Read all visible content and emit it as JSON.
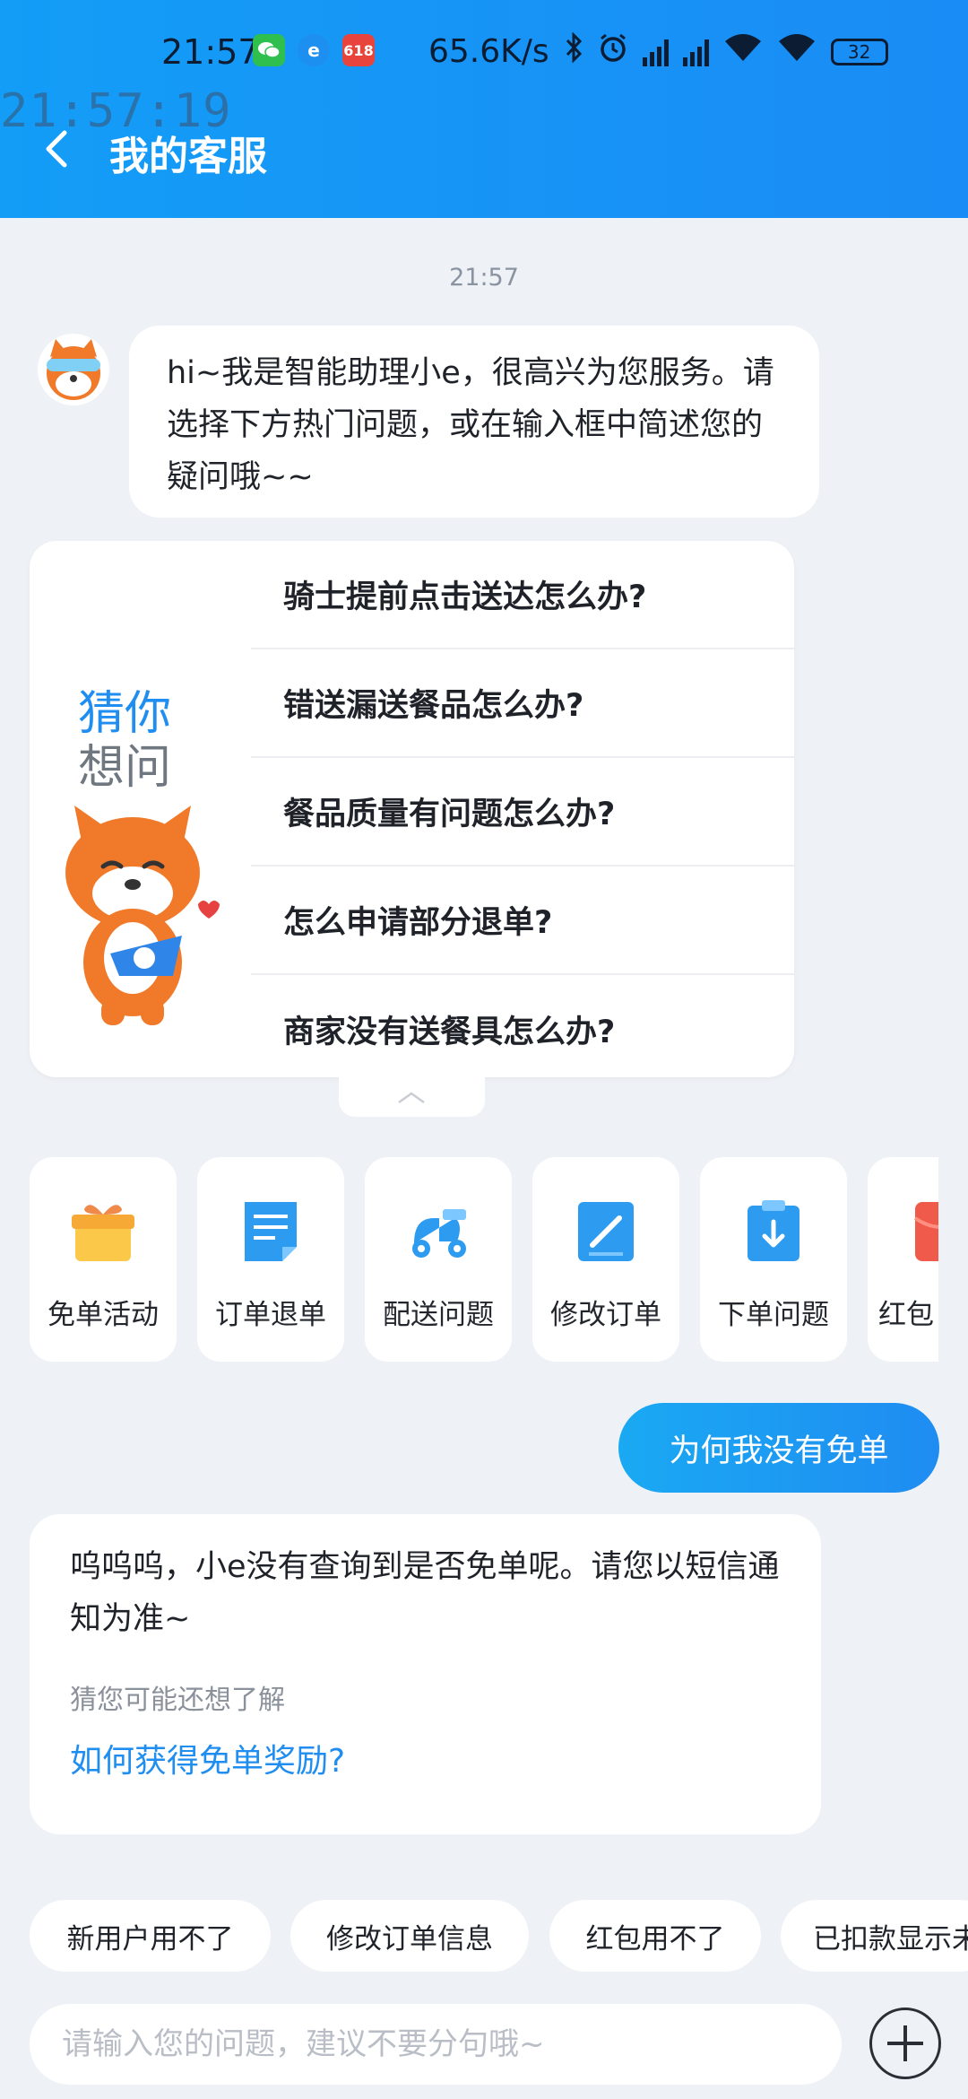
{
  "status_bar": {
    "time": "21:57",
    "net_speed": "65.6K/s",
    "battery": "32",
    "promo_badge": "618",
    "e_badge": "e"
  },
  "overlay_clock": "21:57:19",
  "header": {
    "title": "我的客服"
  },
  "chat": {
    "timestamp": "21:57",
    "welcome": "hi~我是智能助理小e，很高兴为您服务。请选择下方热门问题，或在输入框中简述您的疑问哦~~",
    "guess": {
      "title_line1": "猜你",
      "title_line2": "想问",
      "questions": [
        "骑士提前点击送达怎么办?",
        "错送漏送餐品怎么办?",
        "餐品质量有问题怎么办?",
        "怎么申请部分退单?",
        "商家没有送餐具怎么办?"
      ]
    },
    "categories": [
      {
        "label": "免单活动",
        "icon": "gift-icon"
      },
      {
        "label": "订单退单",
        "icon": "document-icon"
      },
      {
        "label": "配送问题",
        "icon": "scooter-icon"
      },
      {
        "label": "修改订单",
        "icon": "edit-icon"
      },
      {
        "label": "下单问题",
        "icon": "clipboard-download-icon"
      },
      {
        "label": "红包",
        "icon": "red-envelope-icon"
      }
    ],
    "user_message": "为何我没有免单",
    "reply": {
      "text": "呜呜呜，小e没有查询到是否免单呢。请您以短信通知为准~",
      "hint": "猜您可能还想了解",
      "link": "如何获得免单奖励?"
    }
  },
  "quick_chips": [
    "新用户用不了",
    "修改订单信息",
    "红包用不了",
    "已扣款显示未"
  ],
  "input": {
    "placeholder": "请输入您的问题，建议不要分句哦~"
  },
  "colors": {
    "header_blue": "#1a8cf5",
    "link_blue": "#1f8ef0",
    "page_bg": "#eef1f6",
    "mascot_orange": "#f07a2a"
  }
}
